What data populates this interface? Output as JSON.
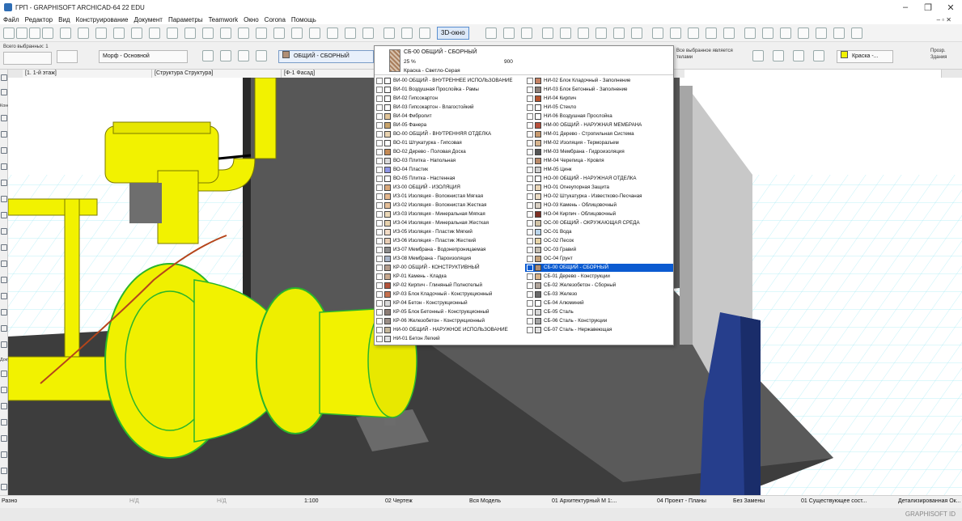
{
  "window": {
    "title": "ГРП - GRAPHISOFT ARCHICAD-64 22 EDU",
    "controls": [
      "–",
      "❐",
      "✕"
    ],
    "doc_controls": "– ▫ ✕"
  },
  "menu": {
    "items": [
      "Файл",
      "Редактор",
      "Вид",
      "Конструирование",
      "Документ",
      "Параметры",
      "Teamwork",
      "Окно",
      "Corona",
      "Помощь"
    ]
  },
  "toolbar": {
    "view3d_label": "3D-окно"
  },
  "info_box": {
    "selected_label": "Всего выбранных: 1",
    "morph_label": "Морф - Основной",
    "surface_label": "ОБЩИЙ - СБОРНЫЙ",
    "all_selected_label": "Все выбранное является телами",
    "paint_label": "Краска -...",
    "transparent_label": "Прозр. Здания"
  },
  "tabs": [
    {
      "label": "[1. 1-й этаж]",
      "active": false
    },
    {
      "label": "[Структура Структура]",
      "active": false
    },
    {
      "label": "[Ф-1 Фасад]",
      "active": false
    },
    {
      "label": "",
      "active": true
    }
  ],
  "left_toolbox": {
    "group_design": "Конст",
    "group_doc": "Доку"
  },
  "dropdown": {
    "header": {
      "name": "СБ-00 ОБЩИЙ - СБОРНЫЙ",
      "percent": "25 %",
      "dimension": "900",
      "paint": "Краска - Светло-Серая"
    },
    "left_column": [
      {
        "name": "ВИ-00 ОБЩИЙ - ВНУТРЕННЕЕ ИСПОЛЬЗОВАНИЕ",
        "color": "#ffffff"
      },
      {
        "name": "ВИ-01 Воздушная Прослойка - Рамы",
        "color": "#ffffff"
      },
      {
        "name": "ВИ-02 Гипсокартон",
        "color": "#ffffff"
      },
      {
        "name": "ВИ-03 Гипсокартон - Влагостойкий",
        "color": "#ffffff"
      },
      {
        "name": "ВИ-04 Фибролит",
        "color": "#e3c69a"
      },
      {
        "name": "ВИ-05 Фанера",
        "color": "#c9a46a"
      },
      {
        "name": "ВО-00 ОБЩИЙ - ВНУТРЕННЯЯ ОТДЕЛКА",
        "color": "#e9d3b0"
      },
      {
        "name": "ВО-01 Штукатурка - Гипсовая",
        "color": "#ffffff"
      },
      {
        "name": "ВО-02 Дерево - Половая Доска",
        "color": "#c48a54"
      },
      {
        "name": "ВО-03 Плитка - Напольная",
        "color": "#d9d9d9"
      },
      {
        "name": "ВО-04 Пластик",
        "color": "#8f96e6"
      },
      {
        "name": "ВО-05 Плитка - Настенная",
        "color": "#ffffff"
      },
      {
        "name": "ИЗ-00 ОБЩИЙ - ИЗОЛЯЦИЯ",
        "color": "#d9a87a"
      },
      {
        "name": "ИЗ-01 Изоляция - Волокнистая Мягкая",
        "color": "#e6b98f"
      },
      {
        "name": "ИЗ-02 Изоляция - Волокнистая Жесткая",
        "color": "#e6c09a"
      },
      {
        "name": "ИЗ-03 Изоляция - Минеральная Мягкая",
        "color": "#ecd9b8"
      },
      {
        "name": "ИЗ-04 Изоляция - Минеральная Жесткая",
        "color": "#e7d2ae"
      },
      {
        "name": "ИЗ-05 Изоляция - Пластик Мягкий",
        "color": "#f2dcc6"
      },
      {
        "name": "ИЗ-06 Изоляция - Пластик Жесткий",
        "color": "#e8cdb5"
      },
      {
        "name": "ИЗ-07 Мембрана - Водонепроницаемая",
        "color": "#8d8d8d"
      },
      {
        "name": "ИЗ-08 Мембрана - Пароизоляция",
        "color": "#a7b4c8"
      },
      {
        "name": "КР-00 ОБЩИЙ - КОНСТРУКТИВНЫЙ",
        "color": "#b39c8c"
      },
      {
        "name": "КР-01 Камень - Кладка",
        "color": "#c9aa90"
      },
      {
        "name": "КР-02 Кирпич - Глиняный Полнотелый",
        "color": "#b4533a"
      },
      {
        "name": "КР-03 Блок Кладочный - Конструкционный",
        "color": "#c7714e"
      },
      {
        "name": "КР-04 Бетон - Конструкционный",
        "color": "#d8d8d8"
      },
      {
        "name": "КР-05 Блок Бетонный - Конструкционный",
        "color": "#8c7c74"
      },
      {
        "name": "КР-06 Железобетон - Конструкционный",
        "color": "#9b8e86"
      },
      {
        "name": "НИ-00 ОБЩИЙ - НАРУЖНОЕ ИСПОЛЬЗОВАНИЕ",
        "color": "#c5b79b"
      },
      {
        "name": "НИ-01 Бетон Легкий",
        "color": "#e2e2e2"
      }
    ],
    "right_column": [
      {
        "name": "НИ-02 Блок Кладочный - Заполнение",
        "color": "#c58264"
      },
      {
        "name": "НИ-03 Блок Бетонный - Заполнение",
        "color": "#8d7f78"
      },
      {
        "name": "НИ-04 Кирпич",
        "color": "#b5532e"
      },
      {
        "name": "НИ-05 Стекло",
        "color": "#ffffff"
      },
      {
        "name": "НИ-06 Воздушная Прослойка",
        "color": "#ffffff"
      },
      {
        "name": "НМ-00 ОБЩИЙ - НАРУЖНАЯ МЕМБРАНА",
        "color": "#b84f3b"
      },
      {
        "name": "НМ-01 Дерево - Стропильная Система",
        "color": "#c89a6e"
      },
      {
        "name": "НМ-02 Изоляция - Терморазъем",
        "color": "#d7b48e"
      },
      {
        "name": "НМ-03 Мембрана - Гидроизоляция",
        "color": "#555555"
      },
      {
        "name": "НМ-04 Черепица - Кровля",
        "color": "#b98a6a"
      },
      {
        "name": "НМ-05 Цинк",
        "color": "#cfcfcf"
      },
      {
        "name": "НО-00 ОБЩИЙ - НАРУЖНАЯ ОТДЕЛКА",
        "color": "#ffffff"
      },
      {
        "name": "НО-01 Огнеупорная Защита",
        "color": "#ead6b8"
      },
      {
        "name": "НО-02 Штукатурка - Известково-Песчаная",
        "color": "#ecdcc4"
      },
      {
        "name": "НО-03 Камень - Облицовочный",
        "color": "#d9d0c4"
      },
      {
        "name": "НО-04 Кирпич - Облицовочный",
        "color": "#7e2f23"
      },
      {
        "name": "ОС-00 ОБЩИЙ - ОКРУЖАЮЩАЯ СРЕДА",
        "color": "#d2c3a6"
      },
      {
        "name": "ОС-01 Вода",
        "color": "#b9d4ea"
      },
      {
        "name": "ОС-02 Песок",
        "color": "#e6d4a8"
      },
      {
        "name": "ОС-03 Гравий",
        "color": "#c4bdb0"
      },
      {
        "name": "ОС-04 Грунт",
        "color": "#c4a27c"
      },
      {
        "name": "СБ-00 ОБЩИЙ - СБОРНЫЙ",
        "color": "#b08f75"
      },
      {
        "name": "СБ-01 Дерево - Конструкции",
        "color": "#d8b38a"
      },
      {
        "name": "СБ-02 Железобетон - Сборный",
        "color": "#b1a69d"
      },
      {
        "name": "СБ-03 Железо",
        "color": "#6b6b6b"
      },
      {
        "name": "СБ-04 Алюминий",
        "color": "#ffffff"
      },
      {
        "name": "СБ-05 Сталь",
        "color": "#d6d6d6"
      },
      {
        "name": "СБ-06 Сталь - Конструкции",
        "color": "#a4a4a4"
      },
      {
        "name": "СБ-07 Сталь - Нержавеющая",
        "color": "#e2e2e2"
      }
    ],
    "selected_index_right": 21,
    "selected_color": "#0b5bd1"
  },
  "statusbar": {
    "left_label": "Разно",
    "nd1": "Н/Д",
    "nd2": "Н/Д",
    "scale": "1:100",
    "layer_combo": "02 Чертеж",
    "model": "Вся Модель",
    "pen_set": "01 Архитектурный М 1:...",
    "model_view": "04 Проект - Планы",
    "renovation": "Без Замены",
    "renovation_filter": "01 Существующее сост...",
    "structure": "Детализированная Ок..."
  },
  "brand": "GRAPHISOFT ID",
  "colors": {
    "accent": "#0b5bd1",
    "pipe_yellow": "#f2f200",
    "grid_cyan": "#7fe3f0",
    "panel_blue": "#263e8c"
  }
}
